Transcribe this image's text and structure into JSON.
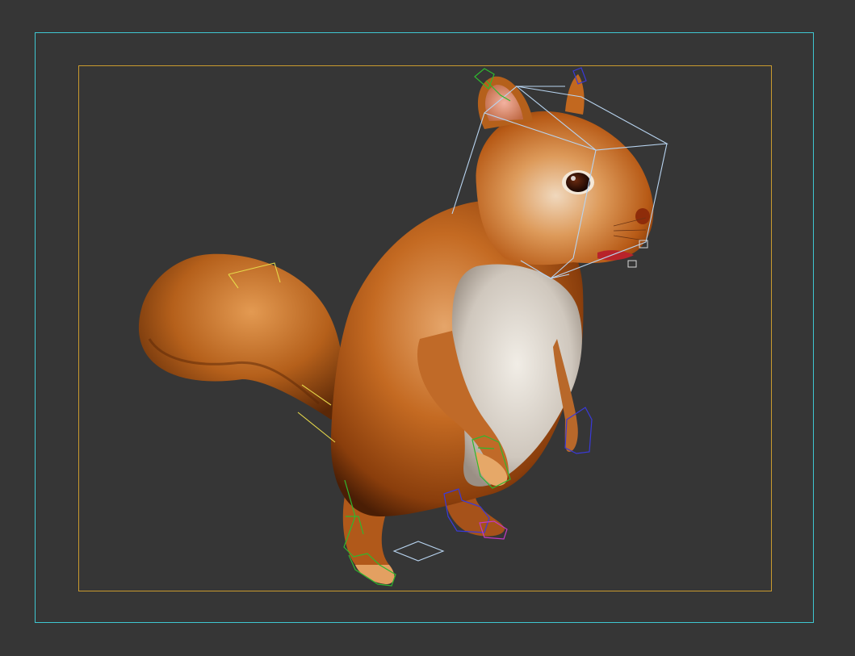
{
  "viewport": {
    "background": "#363636",
    "outer_frame_color": "#3fc7d1",
    "inner_frame_color": "#c99a2e",
    "rig_colors": {
      "head_box": "#b8d4f0",
      "green_gizmo": "#2fb82f",
      "blue_gizmo": "#3a3ad8",
      "yellow_bone": "#e6d84a",
      "magenta_gizmo": "#c23ac2"
    },
    "subject": "squirrel-model"
  }
}
